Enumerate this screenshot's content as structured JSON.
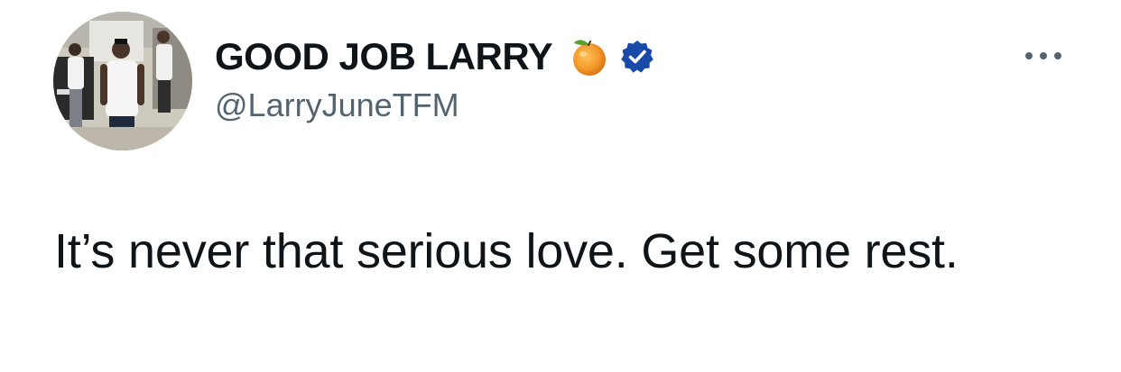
{
  "tweet": {
    "author": {
      "display_name": "GOOD JOB LARRY",
      "handle": "@LarryJuneTFM",
      "avatar": "profile-photo",
      "badges": [
        "orange-emoji-icon",
        "verified-badge-icon"
      ]
    },
    "text": "It’s never that serious love. Get some rest.",
    "more_icon": "more-options-icon"
  },
  "colors": {
    "text_primary": "#0f1419",
    "text_secondary": "#536471",
    "verified_blue": "#1a4aa8",
    "background": "#ffffff"
  }
}
